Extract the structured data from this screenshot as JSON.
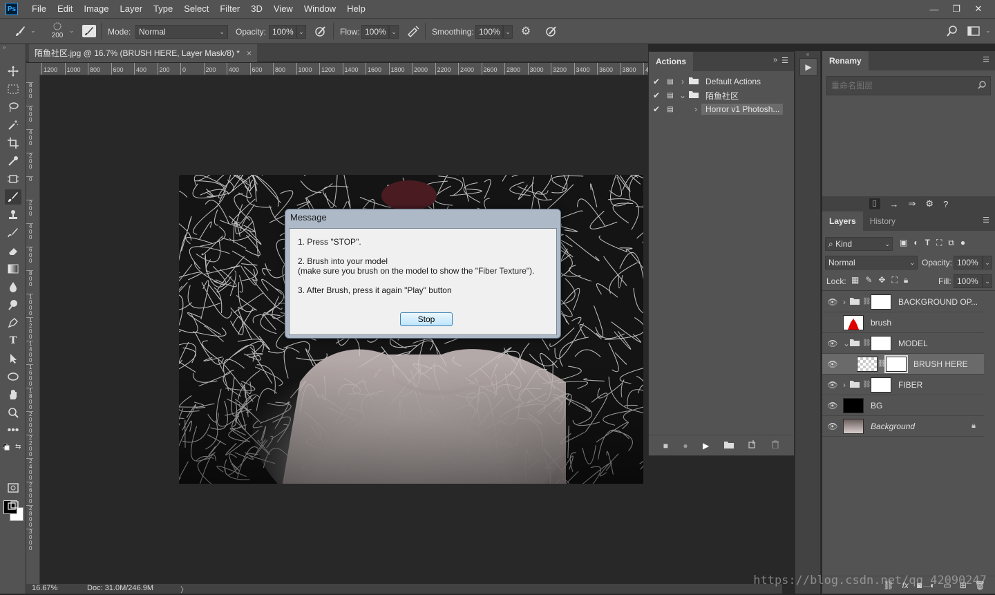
{
  "app": {
    "logo": "Ps"
  },
  "menu": [
    "File",
    "Edit",
    "Image",
    "Layer",
    "Type",
    "Select",
    "Filter",
    "3D",
    "View",
    "Window",
    "Help"
  ],
  "window_controls": {
    "minimize": "—",
    "restore": "❐",
    "close": "✕"
  },
  "options": {
    "brush_size": "200",
    "mode_label": "Mode:",
    "mode_value": "Normal",
    "opacity_label": "Opacity:",
    "opacity_value": "100%",
    "flow_label": "Flow:",
    "flow_value": "100%",
    "smoothing_label": "Smoothing:",
    "smoothing_value": "100%"
  },
  "document": {
    "tab_title": "陌鱼社区.jpg @ 16.7% (BRUSH HERE, Layer Mask/8) *",
    "tab_close": "×"
  },
  "ruler": {
    "horizontal": [
      "1200",
      "1000",
      "800",
      "600",
      "400",
      "200",
      "0",
      "200",
      "400",
      "600",
      "800",
      "1000",
      "1200",
      "1400",
      "1600",
      "1800",
      "2000",
      "2200",
      "2400",
      "2600",
      "2800",
      "3000",
      "3200",
      "3400",
      "3600",
      "3800",
      "40"
    ],
    "vertical": [
      "8\n0\n0",
      "6\n0\n0",
      "4\n0\n0",
      "2\n0\n0",
      "0",
      "2\n0\n0",
      "4\n0\n0",
      "6\n0\n0",
      "8\n0\n0",
      "1\n0\n0\n0",
      "1\n2\n0\n0",
      "1\n4\n0\n0",
      "1\n6\n0\n0",
      "1\n8\n0\n0",
      "2\n0\n0\n0",
      "2\n2\n0\n0",
      "2\n4\n0\n0",
      "2\n6\n0\n0",
      "2\n8\n0\n0",
      "3\n0\n0\n0"
    ]
  },
  "status": {
    "zoom": "16.67%",
    "doc": "Doc: 31.0M/246.9M",
    "arrow": "〉"
  },
  "actions_panel": {
    "tab": "Actions",
    "rows": [
      {
        "label": "Default Actions"
      },
      {
        "label": "陌鱼社区"
      },
      {
        "label": "Horror v1 Photosh..."
      }
    ]
  },
  "renamy_panel": {
    "tab": "Renamy",
    "search_placeholder": "重命名图层"
  },
  "layers_panel": {
    "tabs": [
      "Layers",
      "History"
    ],
    "filter_kind": "Kind",
    "blend_mode": "Normal",
    "opacity_label": "Opacity:",
    "opacity_value": "100%",
    "lock_label": "Lock:",
    "fill_label": "Fill:",
    "fill_value": "100%",
    "layers": [
      {
        "name": "BACKGROUND OP..."
      },
      {
        "name": "brush"
      },
      {
        "name": "MODEL"
      },
      {
        "name": "BRUSH HERE"
      },
      {
        "name": "FIBER"
      },
      {
        "name": "BG"
      },
      {
        "name": "Background"
      }
    ]
  },
  "dialog": {
    "title": "Message",
    "line1": "1. Press \"STOP\".",
    "line2": "2. Brush into your model",
    "line3": "(make sure you brush on the model to show the \"Fiber Texture\").",
    "line4": "3. After Brush, press it again \"Play\" button",
    "button": "Stop"
  },
  "watermark": "https://blog.csdn.net/qq_42090247"
}
